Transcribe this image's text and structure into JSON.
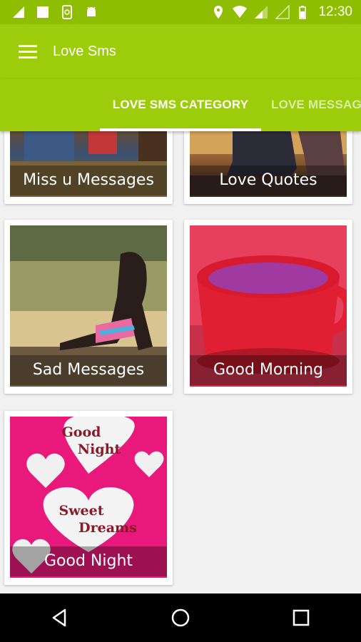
{
  "status_bar": {
    "time": "12:30",
    "left_icons": [
      "signal-icon",
      "square-icon",
      "phone-sync-icon",
      "android-icon"
    ],
    "right_icons": [
      "location-icon",
      "wifi-icon",
      "cell-signal-icon",
      "cell-signal-empty-icon",
      "battery-icon"
    ]
  },
  "toolbar": {
    "title": "Love Sms",
    "menu_icon": "hamburger-menu-icon"
  },
  "tabs": [
    {
      "label": "LOVE SMS CATEGORY",
      "active": true
    },
    {
      "label": "LOVE MESSAGES",
      "active": false
    }
  ],
  "categories": [
    {
      "label": "Miss u Messages"
    },
    {
      "label": "Love Quotes"
    },
    {
      "label": "Sad Messages"
    },
    {
      "label": "Good Morning"
    },
    {
      "label": "Good Night",
      "image_text": [
        "Good",
        "Night",
        "Sweet",
        "Dreams"
      ]
    }
  ],
  "colors": {
    "status_bar": "#8fbe00",
    "toolbar": "#9ccc0a",
    "background": "#f1f1f1"
  },
  "nav": {
    "back_icon": "back-triangle-icon",
    "home_icon": "home-circle-icon",
    "recents_icon": "recents-square-icon"
  }
}
